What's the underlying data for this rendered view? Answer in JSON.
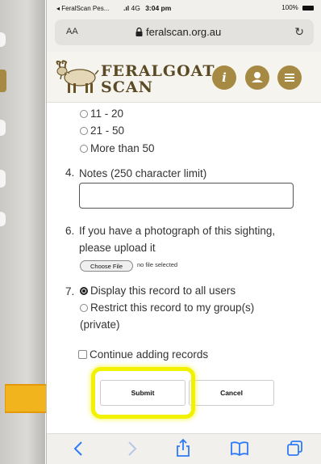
{
  "status_bar": {
    "left": "◂ FeralScan Pes...",
    "carrier": "4G",
    "time": "3:04 pm",
    "battery": "100%"
  },
  "address_bar": {
    "text_size_label": "AA",
    "url": "feralscan.org.au"
  },
  "site": {
    "logo_line1": "FERALGOAT",
    "logo_line2": "SCAN",
    "info_icon": "i"
  },
  "form": {
    "count_options": [
      "11 - 20",
      "21 - 50",
      "More than 50"
    ],
    "q4": {
      "number": "4.",
      "label": "Notes (250 character limit)",
      "value": "",
      "placeholder": ""
    },
    "q6": {
      "number": "6.",
      "line1": "If you have a photograph of this sighting,",
      "line2": "please upload it",
      "file_button": "Choose File",
      "file_status": "no file selected"
    },
    "q7": {
      "number": "7.",
      "option1": "Display this record to all users",
      "option2_line1": "Restrict this record to my group(s)",
      "option2_line2": "(private)",
      "selected": "option1"
    },
    "continue_label": "Continue adding records",
    "submit_label": "Submit",
    "cancel_label": "Cancel"
  },
  "colors": {
    "brand_gold": "#a68a43",
    "brand_brown": "#5b4a26",
    "highlight_yellow": "#f2f200",
    "arrow_orange": "#f2b41c",
    "ios_blue": "#2f7bf6"
  },
  "icons": [
    "back-icon",
    "forward-icon",
    "share-icon",
    "bookmarks-icon",
    "tabs-icon",
    "lock-icon",
    "reload-icon",
    "info-icon",
    "user-icon",
    "menu-icon",
    "goat-logo"
  ]
}
